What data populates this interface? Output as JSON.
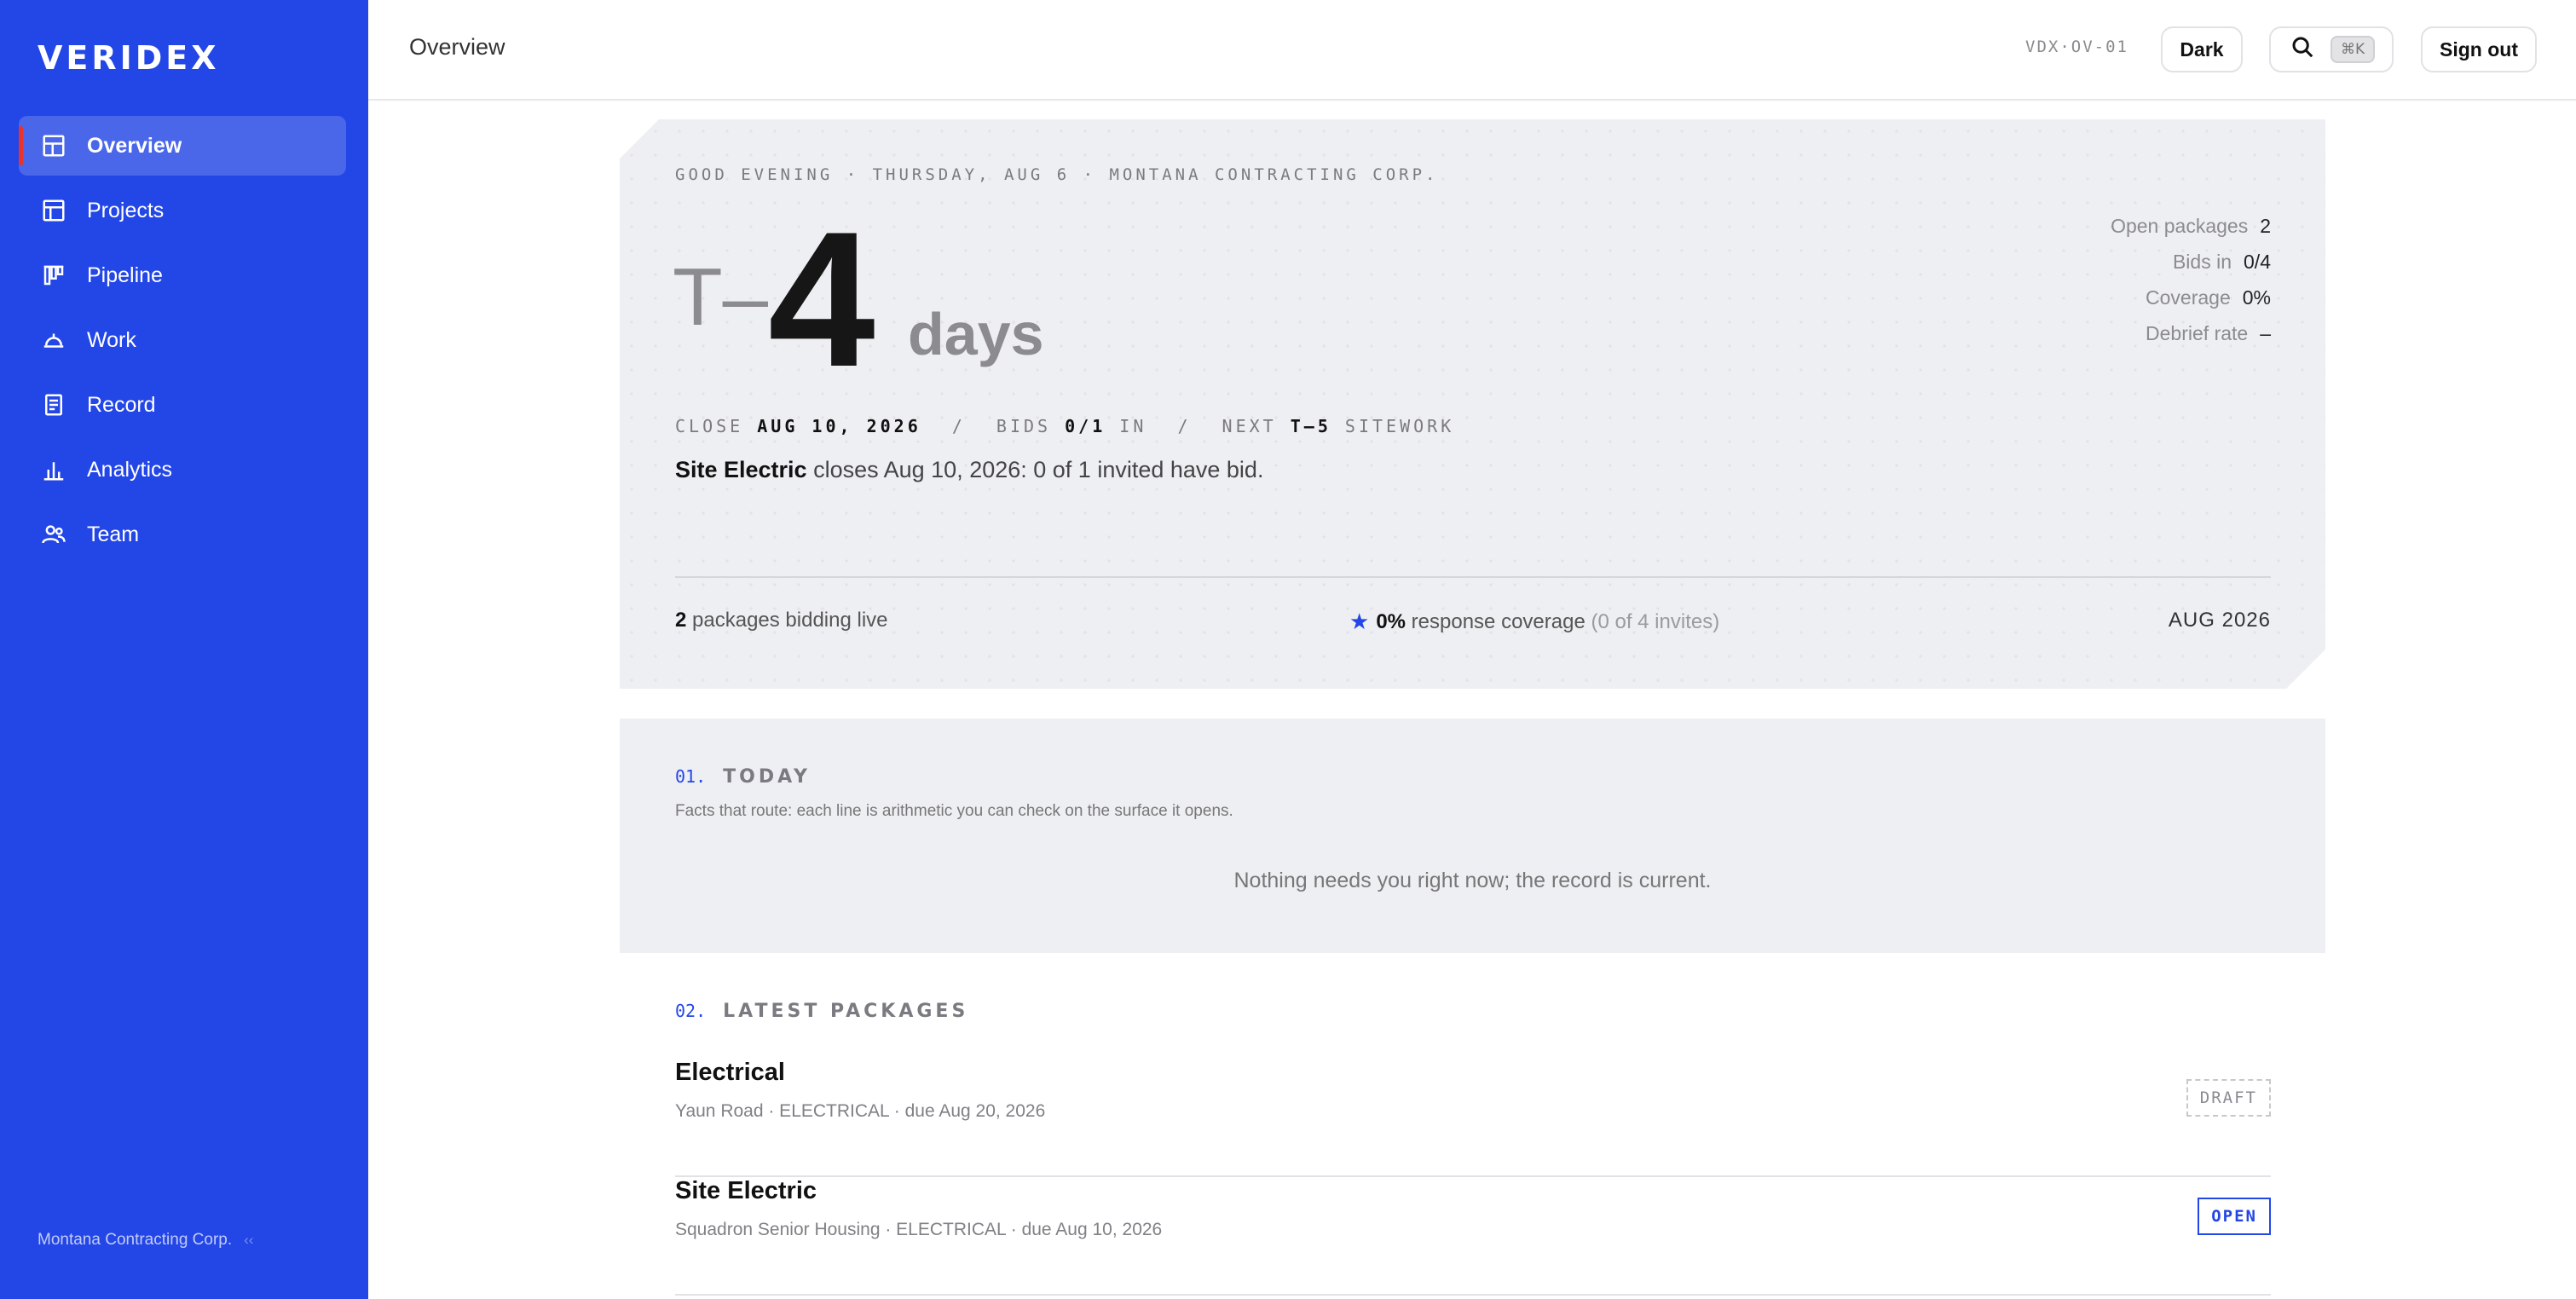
{
  "brand": {
    "logo": "VERIDEX",
    "accent": "#2346e6"
  },
  "sidebar": {
    "items": [
      {
        "label": "Overview",
        "icon": "layout-icon",
        "active": true
      },
      {
        "label": "Projects",
        "icon": "table-icon"
      },
      {
        "label": "Pipeline",
        "icon": "kanban-icon"
      },
      {
        "label": "Work",
        "icon": "hardhat-icon"
      },
      {
        "label": "Record",
        "icon": "document-icon"
      },
      {
        "label": "Analytics",
        "icon": "bar-chart-icon"
      },
      {
        "label": "Team",
        "icon": "users-icon"
      }
    ],
    "footer": {
      "org": "Montana Contracting Corp.",
      "mini": "‹‹"
    }
  },
  "topbar": {
    "title": "Overview",
    "code": "VDX·OV-01",
    "dark_label": "Dark",
    "search_shortcut": "⌘K",
    "signout_label": "Sign out"
  },
  "hero": {
    "greeting": "GOOD EVENING · THURSDAY, AUG 6 · MONTANA CONTRACTING CORP.",
    "prefix": "T–",
    "number": "4",
    "unit": "days",
    "stats": [
      {
        "label": "Open packages",
        "value": "2"
      },
      {
        "label": "Bids in",
        "value": "0/4"
      },
      {
        "label": "Coverage",
        "value": "0%"
      },
      {
        "label": "Debrief rate",
        "value": "–"
      }
    ],
    "meta": {
      "close_label": "CLOSE",
      "close_value": "AUG 10, 2026",
      "bids_label": "BIDS",
      "bids_value": "0/1",
      "bids_suffix": "IN",
      "next_label": "NEXT",
      "next_value": "T–5",
      "next_suffix": "SITEWORK",
      "separator": "/"
    },
    "summary_strong": "Site Electric",
    "summary_rest": " closes Aug 10, 2026: 0 of 1 invited have bid.",
    "foot": {
      "live_count": "2",
      "live_text": " packages bidding live",
      "coverage_value": "0%",
      "coverage_text": " response coverage ",
      "coverage_detail": "(0 of 4 invites)",
      "period": "AUG  2026"
    }
  },
  "today": {
    "number": "01.",
    "title": "TODAY",
    "subtitle": "Facts that route: each line is arithmetic you can check on the surface it opens.",
    "empty": "Nothing needs you right now; the record is current."
  },
  "latest": {
    "number": "02.",
    "title": "LATEST PACKAGES",
    "packages": [
      {
        "name": "Electrical",
        "meta": "Yaun Road · ELECTRICAL · due Aug  20,  2026",
        "status": "DRAFT"
      },
      {
        "name": "Site Electric",
        "meta": "Squadron Senior Housing · ELECTRICAL · due Aug  10,  2026",
        "status": "OPEN"
      }
    ]
  }
}
